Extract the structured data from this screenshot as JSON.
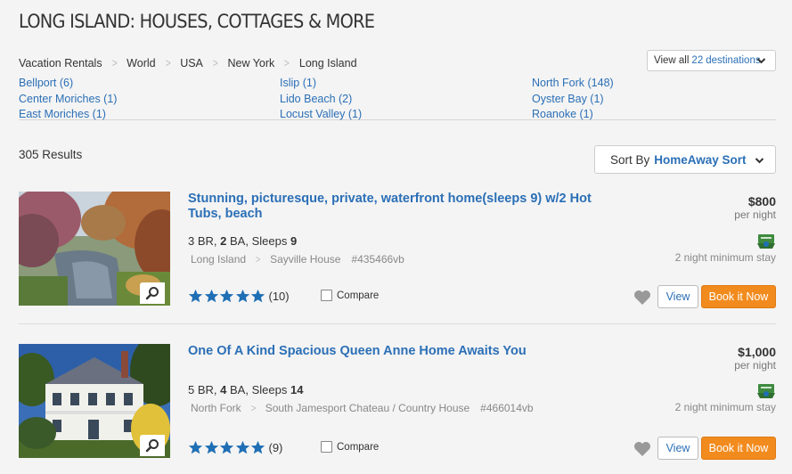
{
  "page": {
    "title": "LONG ISLAND: HOUSES, COTTAGES & MORE"
  },
  "breadcrumb": [
    "Vacation Rentals",
    "World",
    "USA",
    "New York",
    "Long Island"
  ],
  "view_all": {
    "label": "View all",
    "count": "22",
    "suffix": "destinations"
  },
  "destinations": {
    "col1": [
      "Bellport (6)",
      "Center Moriches (1)",
      "East Moriches (1)"
    ],
    "col2": [
      "Islip (1)",
      "Lido Beach (2)",
      "Locust Valley (1)"
    ],
    "col3": [
      "North Fork (148)",
      "Oyster Bay (1)",
      "Roanoke (1)"
    ]
  },
  "results": {
    "count_text": "305 Results",
    "sort_label": "Sort By",
    "sort_value": "HomeAway Sort"
  },
  "listings": [
    {
      "title": "Stunning, picturesque, private, waterfront home(sleeps 9) w/2 Hot Tubs, beach",
      "br": "3",
      "br_label": "BR,",
      "ba": "2",
      "ba_label": "BA, Sleeps",
      "sleeps": "9",
      "location": "Long Island",
      "property": "Sayville House",
      "id": "#435466vb",
      "rating": 5,
      "reviews": "(10)",
      "compare": "Compare",
      "price": "$800",
      "per_night": "per night",
      "min_stay": "2 night minimum stay",
      "view_label": "View",
      "book_label": "Book it Now"
    },
    {
      "title": "One Of A Kind Spacious Queen Anne Home Awaits You",
      "br": "5",
      "br_label": "BR,",
      "ba": "4",
      "ba_label": "BA, Sleeps",
      "sleeps": "14",
      "location": "North Fork",
      "property": "South Jamesport Chateau / Country House",
      "id": "#466014vb",
      "rating": 5,
      "reviews": "(9)",
      "compare": "Compare",
      "price": "$1,000",
      "per_night": "per night",
      "min_stay": "2 night minimum stay",
      "view_label": "View",
      "book_label": "Book it Now"
    }
  ],
  "icons": {
    "breadcrumb_separator": "chevron-right-icon",
    "dropdown": "chevron-down-icon",
    "zoom": "magnifier-icon",
    "star": "star-icon",
    "badge": "free-badge-icon",
    "favorite": "heart-icon"
  },
  "colors": {
    "link": "#2b6fb6",
    "book_button": "#f28b1e",
    "star": "#1f6fb5",
    "badge": "#3f8a3f"
  }
}
